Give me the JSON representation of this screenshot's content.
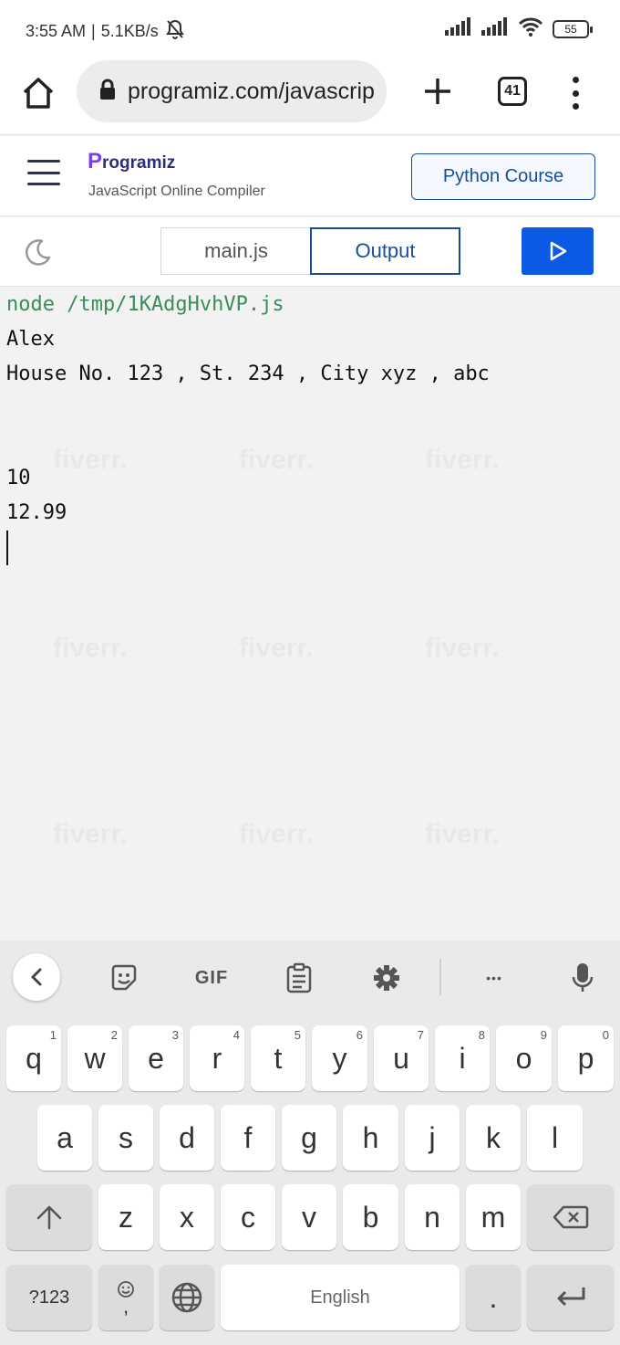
{
  "status_bar": {
    "time": "3:55 AM",
    "separator": "|",
    "speed": "5.1KB/s",
    "battery": "55"
  },
  "browser": {
    "url": "programiz.com/javascrip",
    "tab_count": "41"
  },
  "site": {
    "logo_first": "P",
    "logo_rest": "rogramiz",
    "subtitle": "JavaScript Online Compiler",
    "course_button": "Python Course"
  },
  "editor": {
    "tab_main": "main.js",
    "tab_output": "Output"
  },
  "output": {
    "command": "node /tmp/1KAdgHvhVP.js",
    "lines": [
      "Alex",
      "House No. 123 , St. 234 , City xyz , abc",
      "",
      "",
      "10",
      "12.99"
    ]
  },
  "keyboard": {
    "gif_label": "GIF",
    "more_label": "•••",
    "row1": [
      {
        "key": "q",
        "hint": "1"
      },
      {
        "key": "w",
        "hint": "2"
      },
      {
        "key": "e",
        "hint": "3"
      },
      {
        "key": "r",
        "hint": "4"
      },
      {
        "key": "t",
        "hint": "5"
      },
      {
        "key": "y",
        "hint": "6"
      },
      {
        "key": "u",
        "hint": "7"
      },
      {
        "key": "i",
        "hint": "8"
      },
      {
        "key": "o",
        "hint": "9"
      },
      {
        "key": "p",
        "hint": "0"
      }
    ],
    "row2": [
      "a",
      "s",
      "d",
      "f",
      "g",
      "h",
      "j",
      "k",
      "l"
    ],
    "row3": [
      "z",
      "x",
      "c",
      "v",
      "b",
      "n",
      "m"
    ],
    "symbols_label": "?123",
    "emoji_comma": ",",
    "space_label": "English",
    "period_label": "."
  },
  "colors": {
    "accent_blue": "#0d5ae5",
    "brand_navy": "#1a4c9c",
    "command_green": "#3b8d5b"
  }
}
